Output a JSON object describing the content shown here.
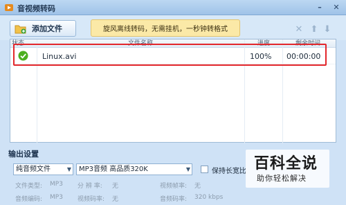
{
  "window": {
    "title": "音视频转码",
    "min_glyph": "–",
    "close_glyph": "✕"
  },
  "toolbar": {
    "add_file_label": "添加文件",
    "banner_text": "旋风离线转码，无需挂机，一秒钟转格式",
    "delete_glyph": "✕",
    "up_glyph": "⬆",
    "down_glyph": "⬇"
  },
  "file_list": {
    "columns": [
      "状态",
      "文件名称",
      "进度",
      "剩余时间"
    ],
    "rows": [
      {
        "status": "done",
        "name": "Linux.avi",
        "progress": "100%",
        "remaining": "00:00:00"
      }
    ]
  },
  "output": {
    "section_label": "输出设置",
    "format_value": "纯音频文件",
    "quality_value": "MP3音频 高品质320K",
    "keep_ratio_label": "保持长宽比",
    "keep_ratio_checked": false,
    "params": [
      {
        "label": "文件类型:",
        "value": "MP3"
      },
      {
        "label": "分 辨 率:",
        "value": "无"
      },
      {
        "label": "视频帧率:",
        "value": "无"
      },
      {
        "label": "音频编码:",
        "value": "MP3"
      },
      {
        "label": "视频码率:",
        "value": "无"
      },
      {
        "label": "音频码率:",
        "value": "320 kbps"
      }
    ]
  },
  "watermark": {
    "main": "百科全说",
    "sub": "助你轻松解决"
  },
  "colors": {
    "accent_red": "#e3262b",
    "banner_bg": "#fbe9a7",
    "status_ok": "#4caf1f"
  }
}
